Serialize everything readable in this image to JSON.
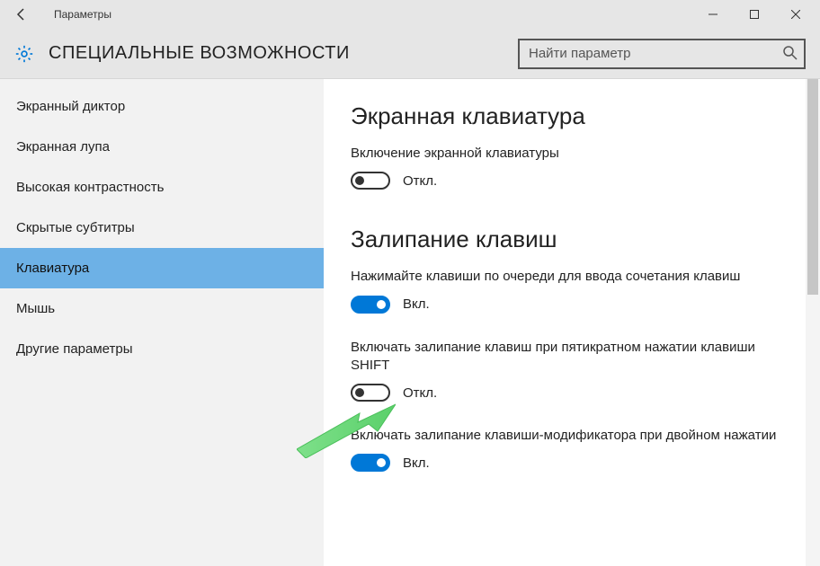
{
  "titlebar": {
    "title": "Параметры"
  },
  "header": {
    "section": "СПЕЦИАЛЬНЫЕ ВОЗМОЖНОСТИ",
    "search_placeholder": "Найти параметр"
  },
  "sidebar": {
    "items": [
      {
        "label": "Экранный диктор"
      },
      {
        "label": "Экранная лупа"
      },
      {
        "label": "Высокая контрастность"
      },
      {
        "label": "Скрытые субтитры"
      },
      {
        "label": "Клавиатура"
      },
      {
        "label": "Мышь"
      },
      {
        "label": "Другие параметры"
      }
    ],
    "selected_index": 4
  },
  "main": {
    "sections": [
      {
        "heading": "Экранная клавиатура",
        "options": [
          {
            "desc": "Включение экранной клавиатуры",
            "on": false,
            "state_label": "Откл."
          }
        ]
      },
      {
        "heading": "Залипание клавиш",
        "options": [
          {
            "desc": "Нажимайте клавиши по очереди для ввода сочетания клавиш",
            "on": true,
            "state_label": "Вкл."
          },
          {
            "desc": "Включать залипание клавиш при пятикратном нажатии клавиши SHIFT",
            "on": false,
            "state_label": "Откл."
          },
          {
            "desc": "Включать залипание клавиши-модификатора при двойном нажатии",
            "on": true,
            "state_label": "Вкл."
          }
        ]
      }
    ]
  }
}
